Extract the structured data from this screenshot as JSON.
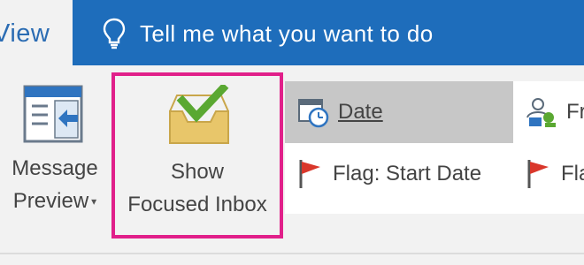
{
  "tabs": {
    "active_tab_label": "View",
    "tell_me_text": "Tell me what you want to do"
  },
  "ribbon": {
    "message_preview": {
      "line1": "Message",
      "line2": "Preview"
    },
    "show_focused_inbox": {
      "line1": "Show",
      "line2": "Focused Inbox"
    },
    "arrangement": {
      "items": [
        {
          "label": "Date",
          "icon": "calendar-clock-icon",
          "selected": true
        },
        {
          "label": "Fr",
          "icon": "people-icon"
        },
        {
          "label": "Flag: Start Date",
          "icon": "red-flag-icon"
        },
        {
          "label": "Fla",
          "icon": "red-flag-icon"
        }
      ]
    }
  },
  "colors": {
    "tab_bar": "#1e6dbb",
    "ribbon_bg": "#f2f2f2",
    "highlight_border": "#e1208a",
    "check_green": "#5aa832",
    "inbox_tray": "#e8c66a",
    "flag_red": "#d9372b"
  }
}
